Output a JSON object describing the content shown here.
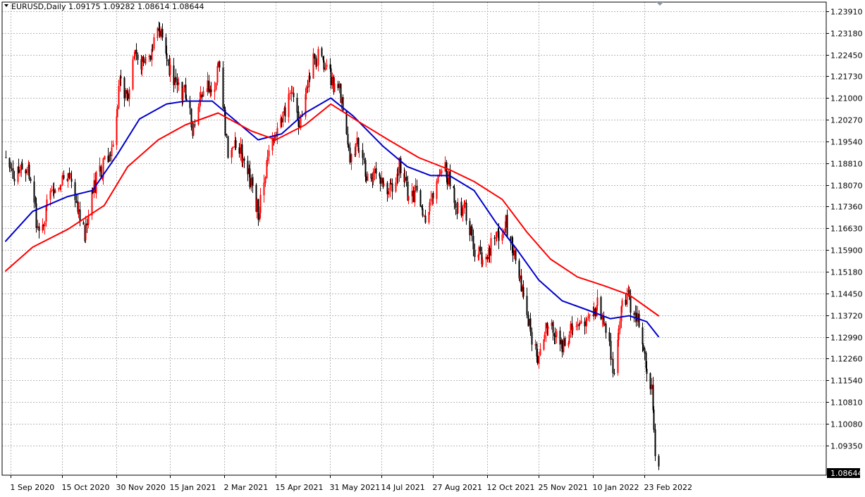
{
  "chart_data": {
    "type": "candlestick",
    "title": "EURUSD,Daily",
    "ohlc_header": "1.09175 1.09282 1.08614 1.08644",
    "current_price_label": "1.08644",
    "current_price": 1.08644,
    "ylim": [
      1.0835,
      1.2422
    ],
    "y_ticks": [
      {
        "value": 1.2391,
        "label": "1.23910"
      },
      {
        "value": 1.2318,
        "label": "1.23180"
      },
      {
        "value": 1.2245,
        "label": "1.22450"
      },
      {
        "value": 1.2173,
        "label": "1.21730"
      },
      {
        "value": 1.21,
        "label": "1.21000"
      },
      {
        "value": 1.2027,
        "label": "1.20270"
      },
      {
        "value": 1.1954,
        "label": "1.19540"
      },
      {
        "value": 1.1881,
        "label": "1.18810"
      },
      {
        "value": 1.1807,
        "label": "1.18070"
      },
      {
        "value": 1.1736,
        "label": "1.17360"
      },
      {
        "value": 1.1663,
        "label": "1.16630"
      },
      {
        "value": 1.159,
        "label": "1.15900"
      },
      {
        "value": 1.1518,
        "label": "1.15180"
      },
      {
        "value": 1.1445,
        "label": "1.14450"
      },
      {
        "value": 1.1372,
        "label": "1.13720"
      },
      {
        "value": 1.1299,
        "label": "1.12990"
      },
      {
        "value": 1.1226,
        "label": "1.12260"
      },
      {
        "value": 1.1154,
        "label": "1.11540"
      },
      {
        "value": 1.1081,
        "label": "1.10810"
      },
      {
        "value": 1.1008,
        "label": "1.10080"
      },
      {
        "value": 1.0935,
        "label": "1.09350"
      }
    ],
    "x_ticks": [
      {
        "date": "2020-09-01",
        "label": "1 Sep 2020"
      },
      {
        "date": "2020-10-15",
        "label": "15 Oct 2020"
      },
      {
        "date": "2020-11-30",
        "label": "30 Nov 2020"
      },
      {
        "date": "2021-01-15",
        "label": "15 Jan 2021"
      },
      {
        "date": "2021-03-02",
        "label": "2 Mar 2021"
      },
      {
        "date": "2021-04-15",
        "label": "15 Apr 2021"
      },
      {
        "date": "2021-05-31",
        "label": "31 May 2021"
      },
      {
        "date": "2021-07-14",
        "label": "14 Jul 2021"
      },
      {
        "date": "2021-08-27",
        "label": "27 Aug 2021"
      },
      {
        "date": "2021-10-12",
        "label": "12 Oct 2021"
      },
      {
        "date": "2021-11-25",
        "label": "25 Nov 2021"
      },
      {
        "date": "2022-01-10",
        "label": "10 Jan 2022"
      },
      {
        "date": "2022-02-23",
        "label": "23 Feb 2022"
      }
    ],
    "date_range": [
      "2020-08-28",
      "2022-03-07"
    ],
    "close_path": [
      {
        "date": "2020-08-28",
        "close": 1.19
      },
      {
        "date": "2020-09-05",
        "close": 1.183
      },
      {
        "date": "2020-09-15",
        "close": 1.187
      },
      {
        "date": "2020-09-25",
        "close": 1.165
      },
      {
        "date": "2020-10-02",
        "close": 1.174
      },
      {
        "date": "2020-10-12",
        "close": 1.18
      },
      {
        "date": "2020-10-22",
        "close": 1.183
      },
      {
        "date": "2020-11-03",
        "close": 1.165
      },
      {
        "date": "2020-11-10",
        "close": 1.18
      },
      {
        "date": "2020-11-18",
        "close": 1.186
      },
      {
        "date": "2020-11-25",
        "close": 1.192
      },
      {
        "date": "2020-12-03",
        "close": 1.214
      },
      {
        "date": "2020-12-10",
        "close": 1.212
      },
      {
        "date": "2020-12-17",
        "close": 1.226
      },
      {
        "date": "2020-12-24",
        "close": 1.22
      },
      {
        "date": "2021-01-06",
        "close": 1.233
      },
      {
        "date": "2021-01-12",
        "close": 1.22
      },
      {
        "date": "2021-01-20",
        "close": 1.215
      },
      {
        "date": "2021-01-28",
        "close": 1.211
      },
      {
        "date": "2021-02-04",
        "close": 1.198
      },
      {
        "date": "2021-02-12",
        "close": 1.212
      },
      {
        "date": "2021-02-20",
        "close": 1.214
      },
      {
        "date": "2021-02-26",
        "close": 1.22
      },
      {
        "date": "2021-03-05",
        "close": 1.192
      },
      {
        "date": "2021-03-12",
        "close": 1.196
      },
      {
        "date": "2021-03-19",
        "close": 1.189
      },
      {
        "date": "2021-03-26",
        "close": 1.179
      },
      {
        "date": "2021-03-31",
        "close": 1.172
      },
      {
        "date": "2021-04-07",
        "close": 1.187
      },
      {
        "date": "2021-04-14",
        "close": 1.196
      },
      {
        "date": "2021-04-21",
        "close": 1.203
      },
      {
        "date": "2021-04-28",
        "close": 1.212
      },
      {
        "date": "2021-05-05",
        "close": 1.201
      },
      {
        "date": "2021-05-12",
        "close": 1.216
      },
      {
        "date": "2021-05-18",
        "close": 1.223
      },
      {
        "date": "2021-05-25",
        "close": 1.224
      },
      {
        "date": "2021-05-28",
        "close": 1.219
      },
      {
        "date": "2021-06-03",
        "close": 1.215
      },
      {
        "date": "2021-06-10",
        "close": 1.211
      },
      {
        "date": "2021-06-17",
        "close": 1.191
      },
      {
        "date": "2021-06-24",
        "close": 1.194
      },
      {
        "date": "2021-07-01",
        "close": 1.185
      },
      {
        "date": "2021-07-08",
        "close": 1.184
      },
      {
        "date": "2021-07-14",
        "close": 1.183
      },
      {
        "date": "2021-07-21",
        "close": 1.179
      },
      {
        "date": "2021-07-30",
        "close": 1.188
      },
      {
        "date": "2021-08-06",
        "close": 1.176
      },
      {
        "date": "2021-08-13",
        "close": 1.179
      },
      {
        "date": "2021-08-20",
        "close": 1.169
      },
      {
        "date": "2021-08-27",
        "close": 1.179
      },
      {
        "date": "2021-09-03",
        "close": 1.188
      },
      {
        "date": "2021-09-10",
        "close": 1.182
      },
      {
        "date": "2021-09-17",
        "close": 1.173
      },
      {
        "date": "2021-09-24",
        "close": 1.172
      },
      {
        "date": "2021-10-01",
        "close": 1.159
      },
      {
        "date": "2021-10-08",
        "close": 1.157
      },
      {
        "date": "2021-10-15",
        "close": 1.16
      },
      {
        "date": "2021-10-22",
        "close": 1.165
      },
      {
        "date": "2021-10-28",
        "close": 1.168
      },
      {
        "date": "2021-11-05",
        "close": 1.156
      },
      {
        "date": "2021-11-12",
        "close": 1.145
      },
      {
        "date": "2021-11-18",
        "close": 1.132
      },
      {
        "date": "2021-11-24",
        "close": 1.122
      },
      {
        "date": "2021-12-02",
        "close": 1.133
      },
      {
        "date": "2021-12-10",
        "close": 1.13
      },
      {
        "date": "2021-12-17",
        "close": 1.127
      },
      {
        "date": "2021-12-24",
        "close": 1.133
      },
      {
        "date": "2021-12-31",
        "close": 1.137
      },
      {
        "date": "2022-01-07",
        "close": 1.136
      },
      {
        "date": "2022-01-14",
        "close": 1.141
      },
      {
        "date": "2022-01-21",
        "close": 1.134
      },
      {
        "date": "2022-01-28",
        "close": 1.115
      },
      {
        "date": "2022-02-04",
        "close": 1.145
      },
      {
        "date": "2022-02-10",
        "close": 1.142
      },
      {
        "date": "2022-02-17",
        "close": 1.136
      },
      {
        "date": "2022-02-24",
        "close": 1.12
      },
      {
        "date": "2022-03-01",
        "close": 1.113
      },
      {
        "date": "2022-03-04",
        "close": 1.093
      },
      {
        "date": "2022-03-07",
        "close": 1.08644
      }
    ],
    "series": [
      {
        "color": "#0000cc",
        "points": [
          {
            "date": "2020-08-28",
            "value": 1.162
          },
          {
            "date": "2020-09-20",
            "value": 1.172
          },
          {
            "date": "2020-10-20",
            "value": 1.177
          },
          {
            "date": "2020-11-10",
            "value": 1.179
          },
          {
            "date": "2020-12-01",
            "value": 1.191
          },
          {
            "date": "2020-12-20",
            "value": 1.203
          },
          {
            "date": "2021-01-12",
            "value": 1.208
          },
          {
            "date": "2021-01-28",
            "value": 1.209
          },
          {
            "date": "2021-02-20",
            "value": 1.209
          },
          {
            "date": "2021-03-10",
            "value": 1.203
          },
          {
            "date": "2021-03-31",
            "value": 1.196
          },
          {
            "date": "2021-04-20",
            "value": 1.198
          },
          {
            "date": "2021-05-10",
            "value": 1.205
          },
          {
            "date": "2021-06-01",
            "value": 1.21
          },
          {
            "date": "2021-06-20",
            "value": 1.204
          },
          {
            "date": "2021-07-15",
            "value": 1.194
          },
          {
            "date": "2021-08-05",
            "value": 1.187
          },
          {
            "date": "2021-08-25",
            "value": 1.184
          },
          {
            "date": "2021-09-10",
            "value": 1.184
          },
          {
            "date": "2021-10-01",
            "value": 1.179
          },
          {
            "date": "2021-10-20",
            "value": 1.168
          },
          {
            "date": "2021-11-05",
            "value": 1.16
          },
          {
            "date": "2021-11-25",
            "value": 1.149
          },
          {
            "date": "2021-12-15",
            "value": 1.142
          },
          {
            "date": "2022-01-05",
            "value": 1.139
          },
          {
            "date": "2022-01-25",
            "value": 1.136
          },
          {
            "date": "2022-02-10",
            "value": 1.137
          },
          {
            "date": "2022-02-25",
            "value": 1.135
          },
          {
            "date": "2022-03-07",
            "value": 1.13
          }
        ]
      },
      {
        "color": "#ff0000",
        "points": [
          {
            "date": "2020-08-28",
            "value": 1.152
          },
          {
            "date": "2020-09-20",
            "value": 1.16
          },
          {
            "date": "2020-10-20",
            "value": 1.166
          },
          {
            "date": "2020-11-20",
            "value": 1.174
          },
          {
            "date": "2020-12-10",
            "value": 1.187
          },
          {
            "date": "2021-01-05",
            "value": 1.196
          },
          {
            "date": "2021-01-28",
            "value": 1.201
          },
          {
            "date": "2021-02-25",
            "value": 1.205
          },
          {
            "date": "2021-03-25",
            "value": 1.199
          },
          {
            "date": "2021-04-15",
            "value": 1.196
          },
          {
            "date": "2021-05-10",
            "value": 1.201
          },
          {
            "date": "2021-06-01",
            "value": 1.208
          },
          {
            "date": "2021-06-25",
            "value": 1.202
          },
          {
            "date": "2021-07-20",
            "value": 1.196
          },
          {
            "date": "2021-08-15",
            "value": 1.19
          },
          {
            "date": "2021-09-10",
            "value": 1.186
          },
          {
            "date": "2021-10-01",
            "value": 1.182
          },
          {
            "date": "2021-10-25",
            "value": 1.176
          },
          {
            "date": "2021-11-15",
            "value": 1.165
          },
          {
            "date": "2021-12-05",
            "value": 1.156
          },
          {
            "date": "2021-12-28",
            "value": 1.15
          },
          {
            "date": "2022-01-20",
            "value": 1.147
          },
          {
            "date": "2022-02-10",
            "value": 1.144
          },
          {
            "date": "2022-03-07",
            "value": 1.137
          }
        ]
      }
    ],
    "bull_color": "#ff0000",
    "bear_color": "#000000",
    "grid": true,
    "grid_color": "#b8b8b8",
    "legend": "none"
  }
}
